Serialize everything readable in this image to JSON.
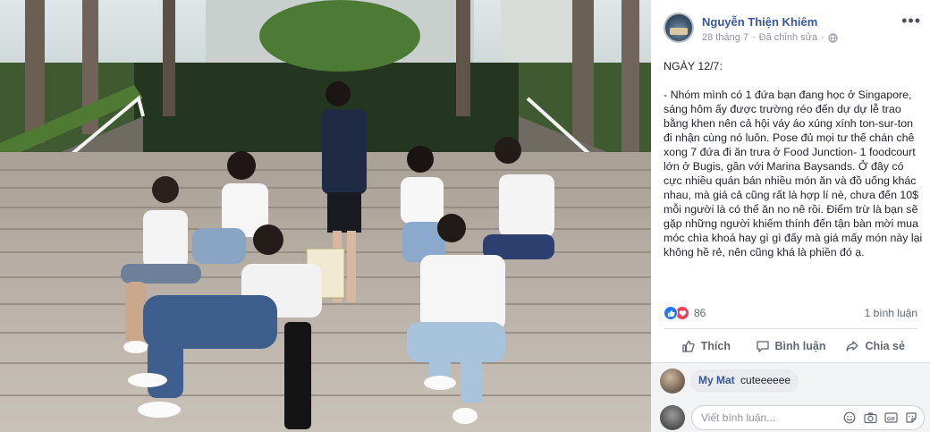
{
  "post": {
    "author": "Nguyễn Thiện Khiêm",
    "date": "28 tháng 7",
    "edited": "Đã chỉnh sửa",
    "title": "NGÀY 12/7:",
    "body": "- Nhóm mình có 1 đứa bạn đang học ở Singapore, sáng hôm ấy được trường réo đến dự dự lễ trao bằng khen nên cả hội váy áo xúng xính ton-sur-ton đi nhận cùng nó luôn. Pose đủ mọi tư thế chán chê xong 7 đứa đi ăn trưa ở Food Junction- 1 foodcourt lớn ở Bugis, gần với Marina Baysands. Ở đây có cực nhiều quán bán nhiều món ăn và đồ uống khác nhau, mà giá cả cũng rất là hợp lí nè, chưa đến 10$ mỗi người là có thể ăn no nê rồi. Điểm trừ là bạn sẽ gặp những người khiếm thính đến tận bàn mời mua móc chìa khoá hay gì gì đấy mà giá mấy món này lại không hề rẻ, nên cũng khá là phiền đó ạ."
  },
  "stats": {
    "reaction_count": "86",
    "comment_count": "1 bình luận"
  },
  "actions": {
    "like": "Thích",
    "comment": "Bình luận",
    "share": "Chia sẻ"
  },
  "comments": [
    {
      "name": "My Mat",
      "text": "cuteeeeee"
    }
  ],
  "compose": {
    "placeholder": "Viết bình luận..."
  },
  "colors": {
    "link": "#385898",
    "like": "#2078f4",
    "love": "#f33e58"
  },
  "icons": [
    "more-icon",
    "globe-icon",
    "like-reaction-icon",
    "love-reaction-icon",
    "like-icon",
    "comment-icon",
    "share-icon",
    "emoji-icon",
    "camera-icon",
    "gif-icon",
    "sticker-icon"
  ]
}
